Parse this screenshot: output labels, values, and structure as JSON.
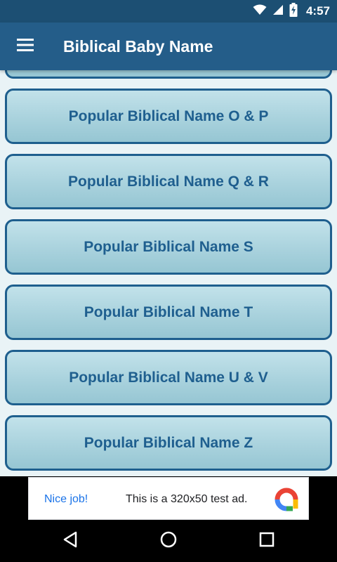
{
  "status_bar": {
    "time": "4:57",
    "icons": [
      "wifi-icon",
      "cellular-signal-icon",
      "battery-charging-icon"
    ]
  },
  "app_bar": {
    "menu_icon": "hamburger-menu-icon",
    "title": "Biblical Baby Name"
  },
  "name_buttons": [
    {
      "label": ""
    },
    {
      "label": "Popular Biblical Name O & P"
    },
    {
      "label": "Popular Biblical Name Q & R"
    },
    {
      "label": "Popular Biblical Name S"
    },
    {
      "label": "Popular Biblical Name T"
    },
    {
      "label": "Popular Biblical Name U & V"
    },
    {
      "label": "Popular Biblical Name Z"
    }
  ],
  "ad": {
    "badge": "Nice job!",
    "text": "This is a 320x50 test ad.",
    "logo_icon": "adchoices-logo-icon"
  },
  "nav_bar": {
    "buttons": [
      "back-icon",
      "home-icon",
      "recents-icon"
    ]
  },
  "colors": {
    "status_bar": "#1c4f73",
    "app_bar": "#245d89",
    "button_border": "#1e5f8e",
    "button_text": "#1f5f8f",
    "background": "#e9f3f6"
  }
}
